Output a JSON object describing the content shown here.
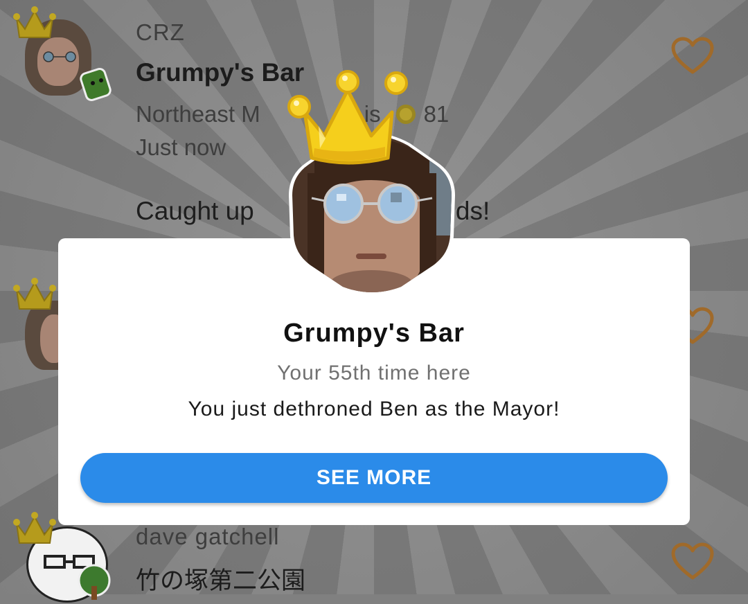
{
  "feed": {
    "items": [
      {
        "user": "CRZ",
        "venue": "Grumpy's Bar",
        "location_visible_left": "Northeast M",
        "location_visible_right": "is",
        "coins": "81",
        "time": "Just now",
        "shout_left": "Caught up",
        "shout_right": "ends!"
      },
      {
        "user": "dave gatchell",
        "venue": "竹の塚第二公園"
      }
    ]
  },
  "modal": {
    "venue": "Grumpy's Bar",
    "visits": "Your 55th time here",
    "message": "You just dethroned Ben as the Mayor!",
    "button_label": "SEE MORE"
  },
  "colors": {
    "button": "#2b8be9",
    "crown": "#f5cf1c",
    "heart": "#a06a2a",
    "coin": "#b7a22e"
  },
  "icons": [
    "crown-icon",
    "heart-icon",
    "coin-icon",
    "sticker-icon"
  ]
}
